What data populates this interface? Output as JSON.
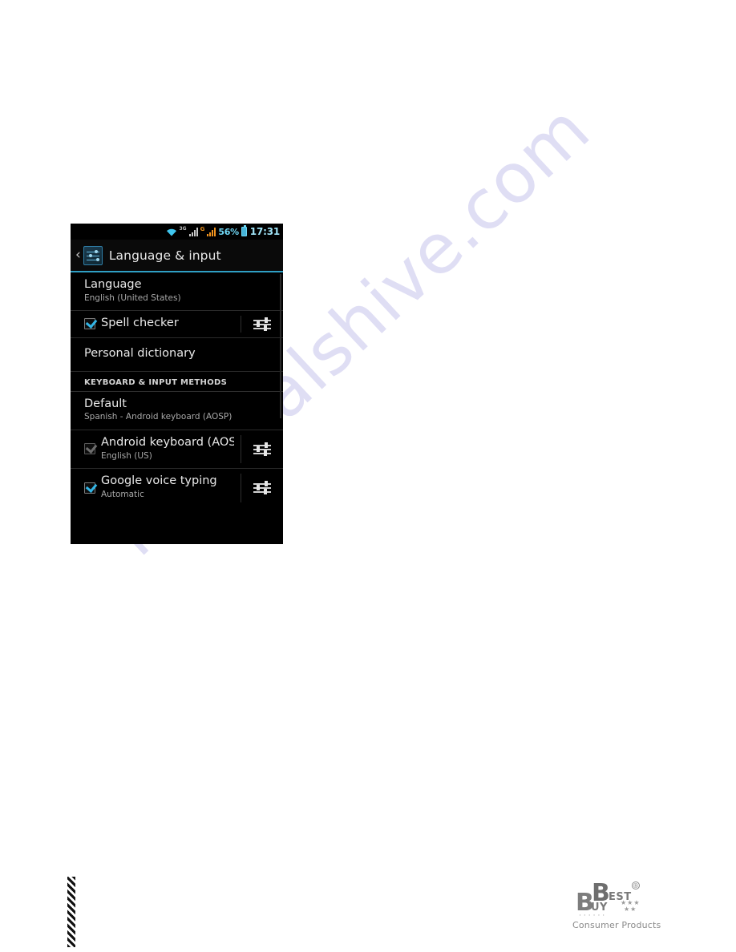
{
  "watermark": {
    "site_text": "manualshive.com"
  },
  "screenshot": {
    "status_bar": {
      "wifi_icon": "wifi-icon",
      "net_3g_label": "3G",
      "net_g_label": "G",
      "battery_percent": "56%",
      "battery_icon": "battery-icon",
      "clock": "17:31"
    },
    "action_bar": {
      "back_chevron": "‹",
      "app_icon": "settings-sliders-icon",
      "title": "Language & input"
    },
    "rows": [
      {
        "name": "language",
        "title": "Language",
        "subtitle": "English (United States)",
        "has_checkbox": false,
        "has_settings": false
      },
      {
        "name": "spell-checker",
        "title": "Spell checker",
        "subtitle": "",
        "has_checkbox": true,
        "checked": true,
        "enabled": true,
        "has_settings": true
      },
      {
        "name": "personal-dictionary",
        "title": "Personal dictionary",
        "subtitle": "",
        "has_checkbox": false,
        "has_settings": false
      }
    ],
    "section_header": "KEYBOARD & INPUT METHODS",
    "keyboard_rows": [
      {
        "name": "default-keyboard",
        "title": "Default",
        "subtitle": "Spanish - Android keyboard (AOSP)",
        "has_checkbox": false,
        "has_settings": false
      },
      {
        "name": "android-keyboard-aosp",
        "title": "Android keyboard (AOSP)",
        "subtitle": "English (US)",
        "has_checkbox": true,
        "checked": true,
        "enabled": false,
        "has_settings": true
      },
      {
        "name": "google-voice-typing",
        "title": "Google voice typing",
        "subtitle": "Automatic",
        "has_checkbox": true,
        "checked": true,
        "enabled": true,
        "has_settings": true
      }
    ],
    "colors": {
      "accent_blue": "#33b5e5",
      "divider_blue": "#2f9fc4",
      "background": "#000000",
      "gsm_orange": "#f0931e"
    }
  },
  "footer_logo": {
    "b_left": "B",
    "b_right": "B",
    "best": "EST",
    "buy": "UY",
    "registered": "®",
    "stars_row1": "★★★",
    "stars_row2": "★★",
    "dots": "······",
    "caption": "Consumer Products"
  }
}
